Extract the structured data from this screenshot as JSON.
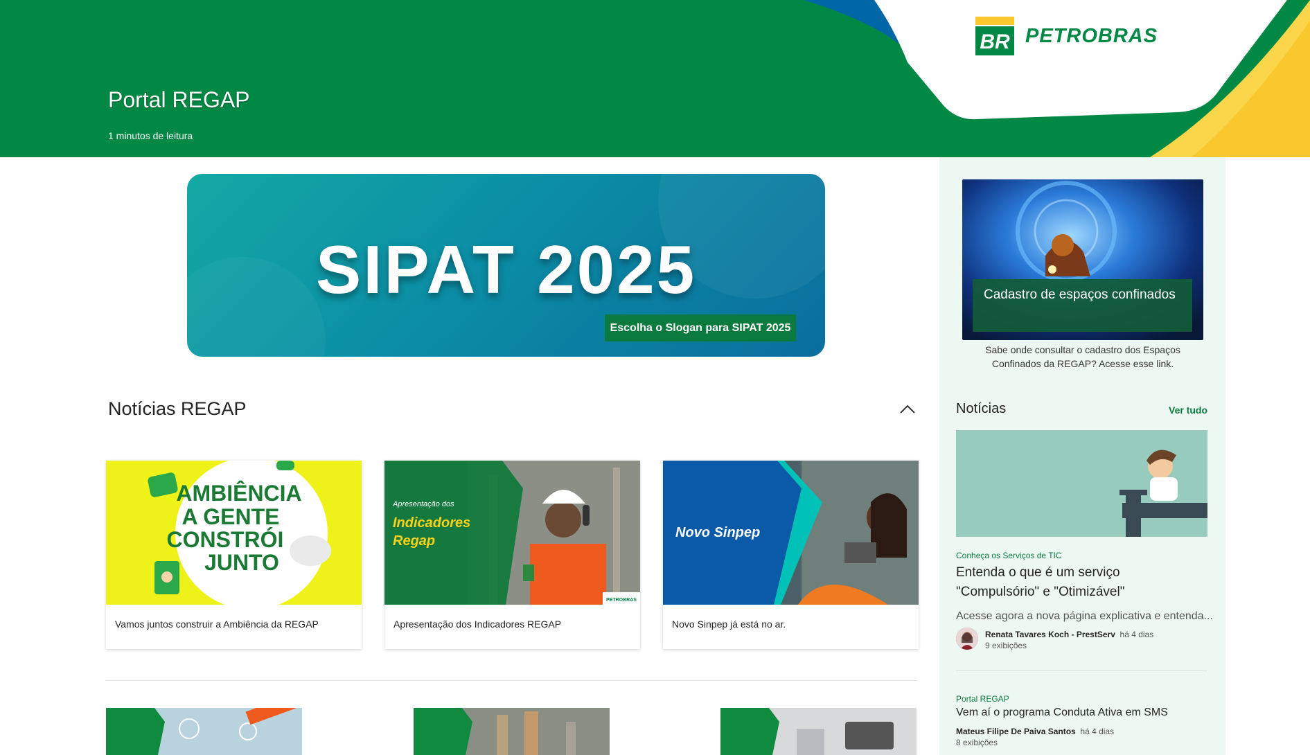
{
  "header": {
    "title": "Portal REGAP",
    "reading_time": "1 minutos de leitura",
    "logo_text": "PETROBRAS",
    "logo_mark": "BR",
    "colors": {
      "green": "#018844",
      "blue": "#0067a7",
      "yellow": "#f8c82e"
    }
  },
  "hero": {
    "title": "SIPAT 2025",
    "button_label": "Escolha o Slogan para SIPAT 2025"
  },
  "news_section": {
    "title": "Notícias REGAP",
    "collapse_icon": "chevron-up-icon",
    "cards": [
      {
        "caption": "Vamos juntos construir a Ambiência da REGAP",
        "image_text": [
          "AMBIÊNCIA",
          "A GENTE",
          "CONSTRÓI",
          "JUNTO"
        ]
      },
      {
        "caption": "Apresentação dos Indicadores REGAP",
        "image_small": "Apresentação dos",
        "image_text": [
          "Indicadores",
          "Regap"
        ],
        "image_brand": "PETROBRAS"
      },
      {
        "caption": "Novo Sinpep já está no ar.",
        "image_text": "Novo Sinpep"
      }
    ]
  },
  "sidebar": {
    "featured": {
      "label": "Cadastro de espaços confinados",
      "description": "Sabe onde consultar o cadastro dos Espaços Confinados da REGAP? Acesse esse link."
    },
    "news_title": "Notícias",
    "see_all": "Ver tudo",
    "items": [
      {
        "category": "Conheça os Serviços de TIC",
        "title": "Entenda o que é um serviço \"Compulsório\" e \"Otimizável\"",
        "description": "Acesse agora a nova página explicativa e entenda...",
        "author": "Renata Tavares Koch - PrestServ",
        "when": "há 4 dias",
        "views": "9 exibições"
      },
      {
        "category": "Portal REGAP",
        "title": "Vem aí o programa Conduta Ativa em SMS",
        "author": "Mateus Filipe De Paiva Santos",
        "when": "há 4 dias",
        "views": "8 exibições"
      }
    ]
  }
}
